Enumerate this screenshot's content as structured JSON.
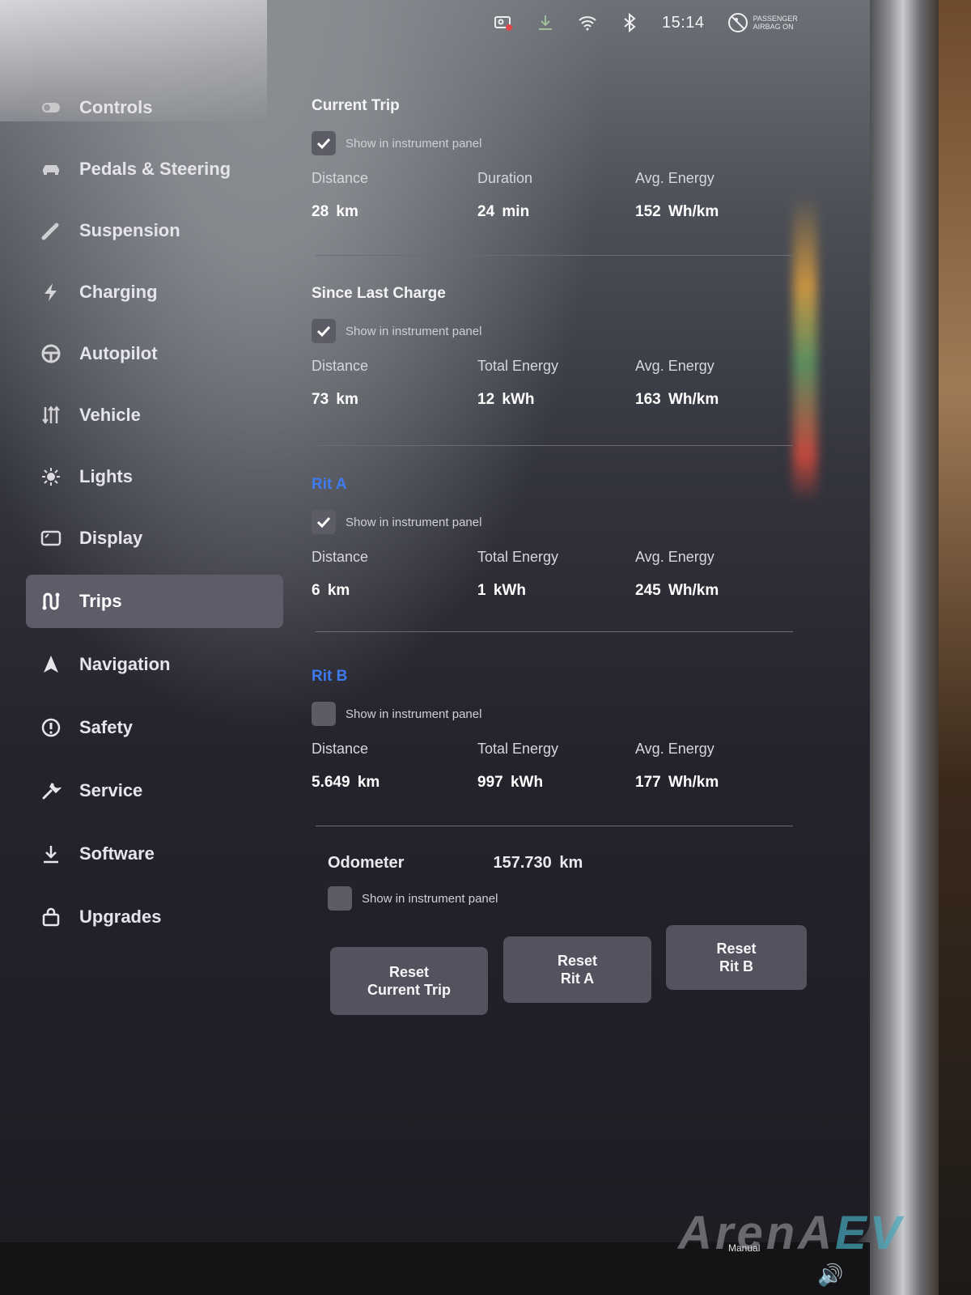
{
  "status_bar": {
    "time": "15:14",
    "icons": [
      "dashcam-icon",
      "download-icon",
      "wifi-icon",
      "bluetooth-icon"
    ],
    "airbag_line1": "PASSENGER",
    "airbag_line2": "AIRBAG ON"
  },
  "sidebar": {
    "active": "Trips",
    "items": [
      {
        "label": "Controls",
        "icon": "toggle-icon"
      },
      {
        "label": "Pedals & Steering",
        "icon": "car-icon"
      },
      {
        "label": "Suspension",
        "icon": "suspension-icon"
      },
      {
        "label": "Charging",
        "icon": "lightning-icon"
      },
      {
        "label": "Autopilot",
        "icon": "steering-wheel-icon"
      },
      {
        "label": "Vehicle",
        "icon": "sliders-icon"
      },
      {
        "label": "Lights",
        "icon": "sun-icon"
      },
      {
        "label": "Display",
        "icon": "display-icon"
      },
      {
        "label": "Trips",
        "icon": "route-icon"
      },
      {
        "label": "Navigation",
        "icon": "navigation-arrow-icon"
      },
      {
        "label": "Safety",
        "icon": "alert-circle-icon"
      },
      {
        "label": "Service",
        "icon": "wrench-icon"
      },
      {
        "label": "Software",
        "icon": "download-icon"
      },
      {
        "label": "Upgrades",
        "icon": "shopping-bag-icon"
      }
    ]
  },
  "trips": {
    "show_label": "Show in instrument panel",
    "current_trip": {
      "title": "Current Trip",
      "show_checked": true,
      "stats": [
        {
          "label": "Distance",
          "value": "28 km"
        },
        {
          "label": "Duration",
          "value": "24 min"
        },
        {
          "label": "Avg. Energy",
          "value": "152 Wh/km"
        }
      ]
    },
    "since_last_charge": {
      "title": "Since Last Charge",
      "show_checked": true,
      "stats": [
        {
          "label": "Distance",
          "value": "73 km"
        },
        {
          "label": "Total Energy",
          "value": "12 kWh"
        },
        {
          "label": "Avg. Energy",
          "value": "163 Wh/km"
        }
      ]
    },
    "rit_a": {
      "title": "Rit A",
      "show_checked": true,
      "stats": [
        {
          "label": "Distance",
          "value": "6 km"
        },
        {
          "label": "Total Energy",
          "value": "1 kWh"
        },
        {
          "label": "Avg. Energy",
          "value": "245 Wh/km"
        }
      ]
    },
    "rit_b": {
      "title": "Rit B",
      "show_checked": false,
      "stats": [
        {
          "label": "Distance",
          "value": "5.649 km"
        },
        {
          "label": "Total Energy",
          "value": "997 kWh"
        },
        {
          "label": "Avg. Energy",
          "value": "177 Wh/km"
        }
      ]
    },
    "odometer": {
      "label": "Odometer",
      "value": "157.730 km",
      "show_checked": false
    },
    "buttons": {
      "reset_current_line1": "Reset",
      "reset_current_line2": "Current Trip",
      "reset_a_line1": "Reset",
      "reset_a_line2": "Rit A",
      "reset_b_line1": "Reset",
      "reset_b_line2": "Rit B"
    },
    "accent_color": "#3e7bf0"
  },
  "bottom": {
    "mode_label": "Manual",
    "watermark_a": "ArenA",
    "watermark_b": "EV"
  }
}
